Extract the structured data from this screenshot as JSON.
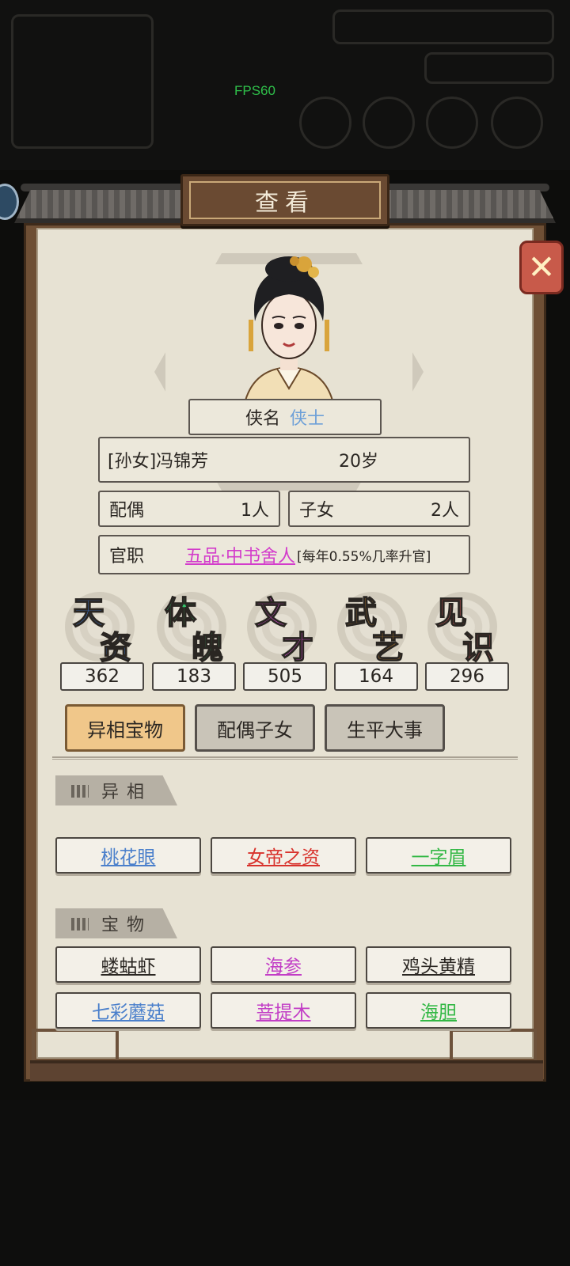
{
  "hud": {
    "fps": "FPS60"
  },
  "dialog": {
    "title": "查看",
    "close_symbol": "✕"
  },
  "character": {
    "name_label": "侠名",
    "name_title": "侠士",
    "relation_name": "[孙女]冯锦芳",
    "age": "20岁",
    "spouse_label": "配偶",
    "spouse_count": "1人",
    "children_label": "子女",
    "children_count": "2人",
    "office_label": "官职",
    "office_rank": "五品·中书舍人",
    "office_note": "[每年0.55%几率升官]"
  },
  "attributes": [
    {
      "c1": "天",
      "c2": "资",
      "value": "362",
      "color": "#3f7fe0"
    },
    {
      "c1": "体",
      "c2": "魄",
      "value": "183",
      "color": "#36c06a"
    },
    {
      "c1": "文",
      "c2": "才",
      "value": "505",
      "color": "#d94fd6"
    },
    {
      "c1": "武",
      "c2": "艺",
      "value": "164",
      "color": "#f0a030"
    },
    {
      "c1": "见",
      "c2": "识",
      "value": "296",
      "color": "#e05a5a"
    }
  ],
  "tabs": [
    {
      "label": "异相宝物",
      "active": true
    },
    {
      "label": "配偶子女",
      "active": false
    },
    {
      "label": "生平大事",
      "active": false
    }
  ],
  "sections": {
    "traits_label": "异相",
    "treasures_label": "宝物"
  },
  "traits": [
    {
      "label": "桃花眼",
      "color": "blue"
    },
    {
      "label": "女帝之资",
      "color": "red"
    },
    {
      "label": "一字眉",
      "color": "green"
    }
  ],
  "treasures": [
    {
      "label": "蝼蛄虾",
      "color": "black"
    },
    {
      "label": "海参",
      "color": "purple"
    },
    {
      "label": "鸡头黄精",
      "color": "black"
    },
    {
      "label": "七彩蘑菇",
      "color": "blue"
    },
    {
      "label": "菩提木",
      "color": "purple"
    },
    {
      "label": "海胆",
      "color": "green"
    }
  ],
  "icons": [
    "close-icon",
    "portrait-avatar"
  ]
}
